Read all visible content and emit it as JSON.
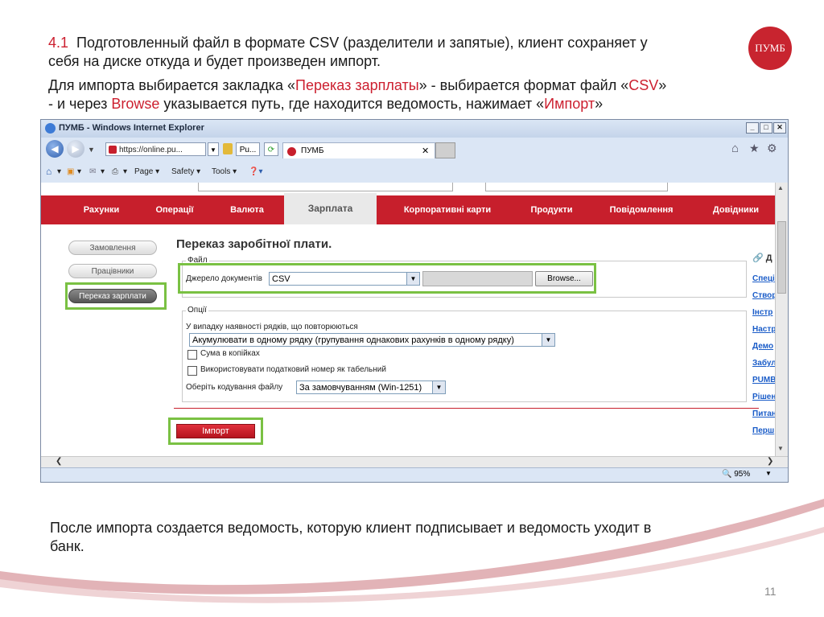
{
  "slide": {
    "heading_line1_num": "4.1",
    "heading_line1_text": "Подготовленный файл в формате CSV (разделители и запятые), клиент сохраняет у",
    "heading_line2": "себя на диске откуда и будет произведен импорт.",
    "para_part1": "Для импорта выбирается закладка «",
    "para_tab": "Переказ зарплаты",
    "para_part2": "» - выбирается формат файл «",
    "para_csv": "CSV",
    "para_part3": "»",
    "para2_part1": "- и через ",
    "para2_browse": "Browse",
    "para2_part2": " указывается путь, где находится ведомость, нажимает «",
    "para2_import": "Импорт",
    "para2_part3": "»",
    "footer_line1": "После импорта создается ведомость, которую клиент подписывает и ведомость уходит в",
    "footer_line2": "банк.",
    "page_number": "11",
    "logo_text": "ПУМБ"
  },
  "browser": {
    "title": "ПУМБ - Windows Internet Explorer",
    "url": "https://online.pu...",
    "cert_label": "Pu...",
    "tab_title": "ПУМБ",
    "cmd": {
      "page": "Page",
      "safety": "Safety",
      "tools": "Tools"
    },
    "zoom": "95%"
  },
  "site": {
    "nav": [
      "Рахунки",
      "Операції",
      "Валюта",
      "Зарплата",
      "Корпоративні карти",
      "Продукти",
      "Повідомлення",
      "Довідники"
    ],
    "active_tab": "Зарплата",
    "side": [
      "Замовлення",
      "Працівники",
      "Переказ зарплати"
    ],
    "page_title": "Переказ заробітної плати.",
    "file_legend": "Файл",
    "source_label": "Джерело документів",
    "source_value": "CSV",
    "browse_label": "Browse...",
    "options_legend": "Опції",
    "dup_label": "У випадку наявності рядків, що повторюються",
    "dup_value": "Акумулювати в одному рядку (групування однакових рахунків в одному рядку)",
    "cb1": "Сума в копійках",
    "cb2": "Використовувати податковий номер як табельний",
    "enc_label": "Оберіть кодування файлу",
    "enc_value": "За замовчуванням (Win-1251)",
    "import_label": "Імпорт",
    "right_heading": "Д",
    "right_links": [
      "Спеці",
      "Створ",
      "Інстр",
      "Настр",
      "Демо",
      "Забул",
      "PUMB",
      "Рішен",
      "Питан",
      "Перш"
    ]
  },
  "colors": {
    "brand_red": "#c71f2c",
    "highlight_green": "#7ac143",
    "link_blue": "#1a5cc8"
  },
  "icons": [
    "back-arrow-icon",
    "forward-arrow-icon",
    "lock-icon",
    "refresh-icon",
    "home-icon",
    "star-icon",
    "gear-icon",
    "close-icon",
    "feed-icon",
    "mail-icon",
    "print-icon",
    "help-icon",
    "zoom-icon",
    "link-icon"
  ]
}
